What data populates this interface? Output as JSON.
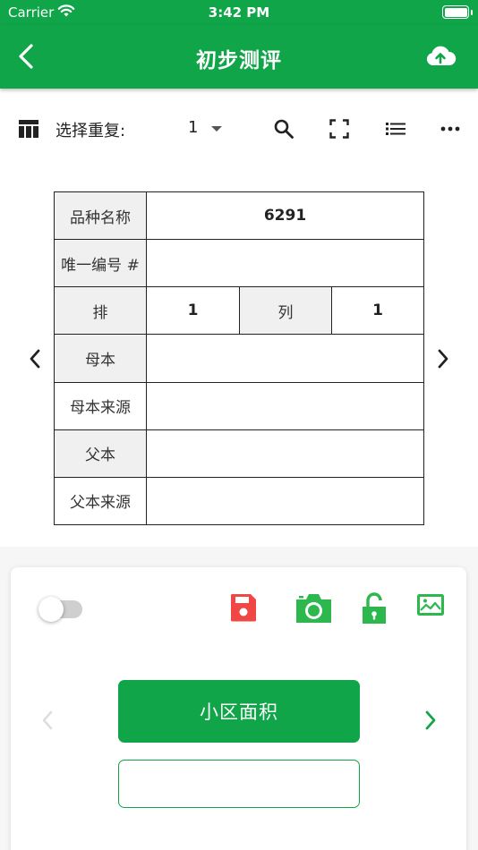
{
  "status_bar": {
    "carrier": "Carrier",
    "time": "3:42 PM"
  },
  "nav": {
    "title": "初步测评",
    "back_icon": "chevron-left-icon",
    "upload_icon": "cloud-upload-icon"
  },
  "toolbar": {
    "label": "选择重复:",
    "repeat_value": "1"
  },
  "grid": {
    "variety_label": "品种名称",
    "variety_value": "6291",
    "uid_label": "唯一编号 #",
    "uid_value": "",
    "row_label": "排",
    "row_value": "1",
    "col_label": "列",
    "col_value": "1",
    "mother_label": "母本",
    "mother_value": "",
    "mother_source_label": "母本来源",
    "mother_source_value": "",
    "father_label": "父本",
    "father_value": "",
    "father_source_label": "父本来源",
    "father_source_value": ""
  },
  "trait": {
    "name": "小区面积",
    "value": "",
    "placeholder": ""
  },
  "colors": {
    "primary": "#0fa548",
    "save_red": "#f04646",
    "camera_green": "#2db84d"
  }
}
